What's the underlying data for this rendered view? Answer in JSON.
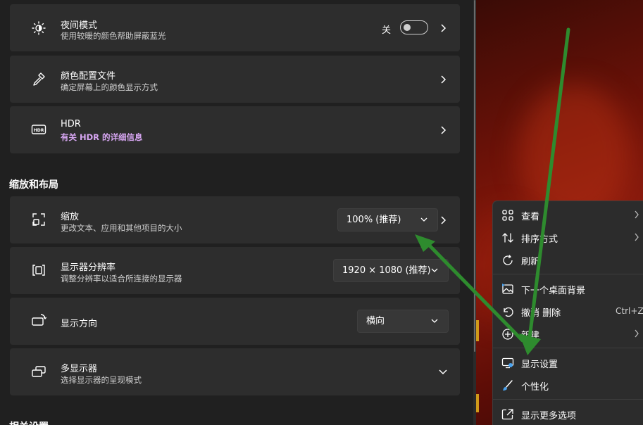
{
  "night_light": {
    "title": "夜间模式",
    "subtitle": "使用较暖的颜色帮助屏蔽蓝光",
    "toggle_state": "关",
    "toggle_on": false
  },
  "color_profile": {
    "title": "颜色配置文件",
    "subtitle": "确定屏幕上的颜色显示方式"
  },
  "hdr": {
    "title": "HDR",
    "subtitle": "有关 HDR 的详细信息"
  },
  "scale_layout": {
    "section_title": "缩放和布局",
    "scale": {
      "title": "缩放",
      "subtitle": "更改文本、应用和其他项目的大小",
      "value": "100% (推荐)"
    },
    "resolution": {
      "title": "显示器分辨率",
      "subtitle": "调整分辨率以适合所连接的显示器",
      "value": "1920 × 1080 (推荐)"
    },
    "orientation": {
      "title": "显示方向",
      "value": "横向"
    },
    "multi_display": {
      "title": "多显示器",
      "subtitle": "选择显示器的呈现模式"
    }
  },
  "related_section_title": "相关设置",
  "context_menu": {
    "items": [
      {
        "label": "查看",
        "icon": "grid-icon",
        "submenu": true
      },
      {
        "label": "排序方式",
        "icon": "sort-icon",
        "submenu": true
      },
      {
        "label": "刷新",
        "icon": "refresh-icon"
      },
      {
        "label": "下一个桌面背景",
        "icon": "picture-icon"
      },
      {
        "label": "撤消 删除",
        "icon": "undo-icon",
        "shortcut": "Ctrl+Z"
      },
      {
        "label": "新建",
        "icon": "new-icon",
        "submenu": true
      },
      {
        "label": "显示设置",
        "icon": "display-settings-icon"
      },
      {
        "label": "个性化",
        "icon": "brush-icon"
      },
      {
        "label": "显示更多选项",
        "icon": "more-options-icon"
      }
    ]
  },
  "colors": {
    "accent_link": "#d7a6f2",
    "annotation_arrow": "#2e8b2e",
    "card_bg": "#2d2d2d",
    "page_bg": "#202020"
  }
}
